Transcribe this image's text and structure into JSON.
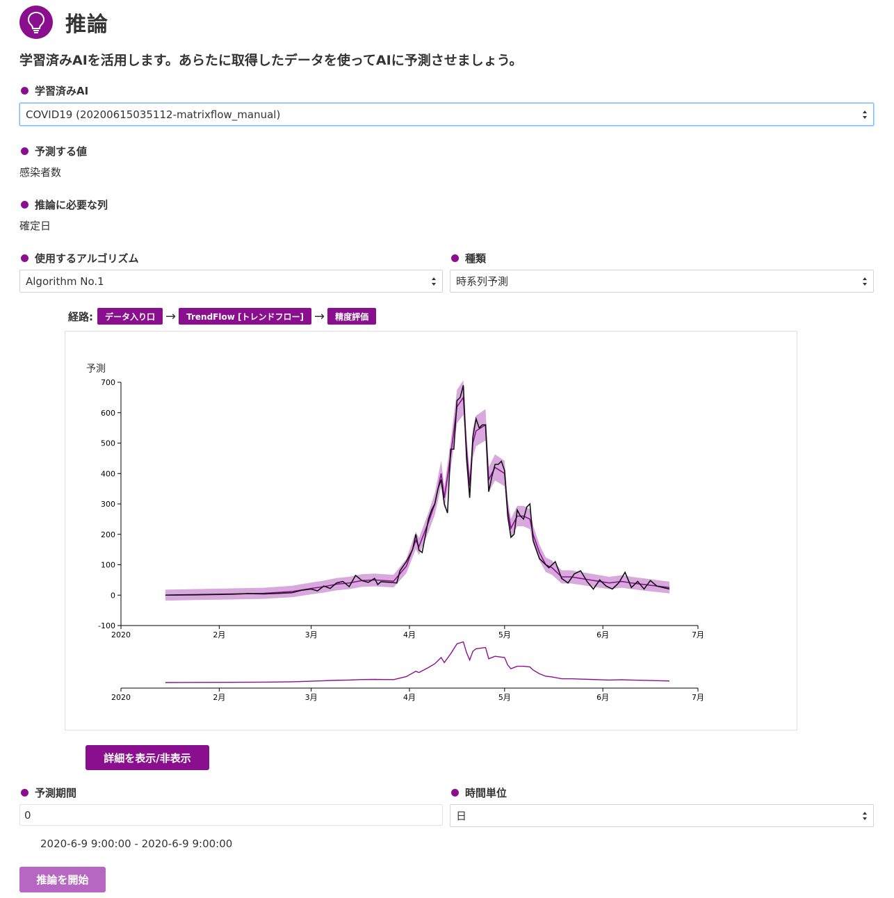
{
  "header": {
    "title": "推論",
    "icon": "lightbulb-icon"
  },
  "subtitle": "学習済みAIを活用します。あらたに取得したデータを使ってAIに予測させましょう。",
  "model": {
    "label": "学習済みAI",
    "selected": "COVID19 (20200615035112-matrixflow_manual)"
  },
  "target": {
    "label": "予測する値",
    "value": "感染者数"
  },
  "required_columns": {
    "label": "推論に必要な列",
    "value": "確定日"
  },
  "algorithm": {
    "label": "使用するアルゴリズム",
    "selected": "Algorithm No.1"
  },
  "kind": {
    "label": "種類",
    "selected": "時系列予測"
  },
  "route": {
    "label": "経路:",
    "steps": [
      "データ入り口",
      "TrendFlow [トレンドフロー]",
      "精度評価"
    ],
    "arrow": "→"
  },
  "detail_button": "詳細を表示/非表示",
  "period": {
    "label": "予測期間",
    "value": "0",
    "range_text": "2020-6-9 9:00:00 - 2020-6-9 9:00:00"
  },
  "time_unit": {
    "label": "時間単位",
    "selected": "日"
  },
  "start_button": "推論を開始",
  "colors": {
    "accent": "#8a0f8e",
    "band": "#d8a9dd",
    "start_button": "#b667c1"
  },
  "chart_data": {
    "type": "line",
    "ylabel": "予測",
    "ylim": [
      -100,
      700
    ],
    "yticks": [
      -100,
      0,
      100,
      200,
      300,
      400,
      500,
      600,
      700
    ],
    "xlim": [
      "2020-01-01",
      "2020-07-01"
    ],
    "xticks": [
      {
        "date": "2020-01-01",
        "label": "2020"
      },
      {
        "date": "2020-02-01",
        "label": "2月"
      },
      {
        "date": "2020-03-01",
        "label": "3月"
      },
      {
        "date": "2020-04-01",
        "label": "4月"
      },
      {
        "date": "2020-05-01",
        "label": "5月"
      },
      {
        "date": "2020-06-01",
        "label": "6月"
      },
      {
        "date": "2020-07-01",
        "label": "7月"
      }
    ],
    "series": [
      {
        "color": "#111111",
        "points": [
          [
            "2020-01-15",
            0
          ],
          [
            "2020-01-25",
            1
          ],
          [
            "2020-02-05",
            3
          ],
          [
            "2020-02-10",
            5
          ],
          [
            "2020-02-15",
            4
          ],
          [
            "2020-02-20",
            6
          ],
          [
            "2020-02-24",
            8
          ],
          [
            "2020-02-27",
            16
          ],
          [
            "2020-03-01",
            20
          ],
          [
            "2020-03-03",
            14
          ],
          [
            "2020-03-05",
            30
          ],
          [
            "2020-03-07",
            22
          ],
          [
            "2020-03-09",
            40
          ],
          [
            "2020-03-11",
            45
          ],
          [
            "2020-03-13",
            28
          ],
          [
            "2020-03-15",
            65
          ],
          [
            "2020-03-17",
            48
          ],
          [
            "2020-03-19",
            42
          ],
          [
            "2020-03-21",
            55
          ],
          [
            "2020-03-22",
            35
          ],
          [
            "2020-03-23",
            44
          ],
          [
            "2020-03-26",
            42
          ],
          [
            "2020-03-28",
            40
          ],
          [
            "2020-03-29",
            80
          ],
          [
            "2020-03-31",
            110
          ],
          [
            "2020-04-02",
            150
          ],
          [
            "2020-04-03",
            200
          ],
          [
            "2020-04-04",
            148
          ],
          [
            "2020-04-05",
            140
          ],
          [
            "2020-04-07",
            250
          ],
          [
            "2020-04-08",
            280
          ],
          [
            "2020-04-09",
            300
          ],
          [
            "2020-04-10",
            350
          ],
          [
            "2020-04-11",
            380
          ],
          [
            "2020-04-12",
            300
          ],
          [
            "2020-04-13",
            270
          ],
          [
            "2020-04-14",
            480
          ],
          [
            "2020-04-15",
            480
          ],
          [
            "2020-04-16",
            640
          ],
          [
            "2020-04-17",
            650
          ],
          [
            "2020-04-18",
            690
          ],
          [
            "2020-04-19",
            450
          ],
          [
            "2020-04-20",
            320
          ],
          [
            "2020-04-21",
            520
          ],
          [
            "2020-04-22",
            580
          ],
          [
            "2020-04-23",
            550
          ],
          [
            "2020-04-24",
            560
          ],
          [
            "2020-04-25",
            560
          ],
          [
            "2020-04-26",
            340
          ],
          [
            "2020-04-27",
            390
          ],
          [
            "2020-04-28",
            430
          ],
          [
            "2020-04-29",
            430
          ],
          [
            "2020-04-30",
            440
          ],
          [
            "2020-05-01",
            410
          ],
          [
            "2020-05-02",
            260
          ],
          [
            "2020-05-03",
            190
          ],
          [
            "2020-05-04",
            200
          ],
          [
            "2020-05-05",
            280
          ],
          [
            "2020-05-06",
            260
          ],
          [
            "2020-05-07",
            250
          ],
          [
            "2020-05-08",
            290
          ],
          [
            "2020-05-09",
            300
          ],
          [
            "2020-05-10",
            180
          ],
          [
            "2020-05-11",
            150
          ],
          [
            "2020-05-12",
            120
          ],
          [
            "2020-05-13",
            110
          ],
          [
            "2020-05-15",
            90
          ],
          [
            "2020-05-17",
            110
          ],
          [
            "2020-05-19",
            55
          ],
          [
            "2020-05-21",
            40
          ],
          [
            "2020-05-23",
            70
          ],
          [
            "2020-05-25",
            80
          ],
          [
            "2020-05-27",
            45
          ],
          [
            "2020-05-29",
            20
          ],
          [
            "2020-05-31",
            50
          ],
          [
            "2020-06-02",
            30
          ],
          [
            "2020-06-04",
            20
          ],
          [
            "2020-06-06",
            40
          ],
          [
            "2020-06-08",
            75
          ],
          [
            "2020-06-10",
            25
          ],
          [
            "2020-06-12",
            45
          ],
          [
            "2020-06-14",
            20
          ],
          [
            "2020-06-16",
            48
          ],
          [
            "2020-06-18",
            30
          ],
          [
            "2020-06-20",
            25
          ],
          [
            "2020-06-22",
            20
          ]
        ]
      },
      {
        "color": "#8a0f8e",
        "points": [
          [
            "2020-01-15",
            0
          ],
          [
            "2020-01-25",
            2
          ],
          [
            "2020-02-05",
            4
          ],
          [
            "2020-02-15",
            6
          ],
          [
            "2020-02-24",
            12
          ],
          [
            "2020-03-01",
            22
          ],
          [
            "2020-03-05",
            28
          ],
          [
            "2020-03-09",
            36
          ],
          [
            "2020-03-13",
            40
          ],
          [
            "2020-03-17",
            48
          ],
          [
            "2020-03-21",
            50
          ],
          [
            "2020-03-24",
            48
          ],
          [
            "2020-03-27",
            46
          ],
          [
            "2020-03-31",
            95
          ],
          [
            "2020-04-03",
            180
          ],
          [
            "2020-04-04",
            160
          ],
          [
            "2020-04-07",
            240
          ],
          [
            "2020-04-09",
            300
          ],
          [
            "2020-04-11",
            400
          ],
          [
            "2020-04-12",
            320
          ],
          [
            "2020-04-14",
            460
          ],
          [
            "2020-04-16",
            620
          ],
          [
            "2020-04-18",
            650
          ],
          [
            "2020-04-19",
            480
          ],
          [
            "2020-04-20",
            360
          ],
          [
            "2020-04-21",
            500
          ],
          [
            "2020-04-22",
            540
          ],
          [
            "2020-04-25",
            560
          ],
          [
            "2020-04-26",
            380
          ],
          [
            "2020-04-28",
            420
          ],
          [
            "2020-05-01",
            400
          ],
          [
            "2020-05-02",
            280
          ],
          [
            "2020-05-03",
            220
          ],
          [
            "2020-05-05",
            260
          ],
          [
            "2020-05-07",
            260
          ],
          [
            "2020-05-09",
            250
          ],
          [
            "2020-05-10",
            200
          ],
          [
            "2020-05-12",
            140
          ],
          [
            "2020-05-14",
            100
          ],
          [
            "2020-05-16",
            90
          ],
          [
            "2020-05-19",
            60
          ],
          [
            "2020-05-22",
            60
          ],
          [
            "2020-05-25",
            55
          ],
          [
            "2020-05-28",
            50
          ],
          [
            "2020-05-31",
            45
          ],
          [
            "2020-06-03",
            40
          ],
          [
            "2020-06-07",
            45
          ],
          [
            "2020-06-10",
            40
          ],
          [
            "2020-06-14",
            35
          ],
          [
            "2020-06-18",
            30
          ],
          [
            "2020-06-22",
            25
          ]
        ]
      }
    ]
  }
}
